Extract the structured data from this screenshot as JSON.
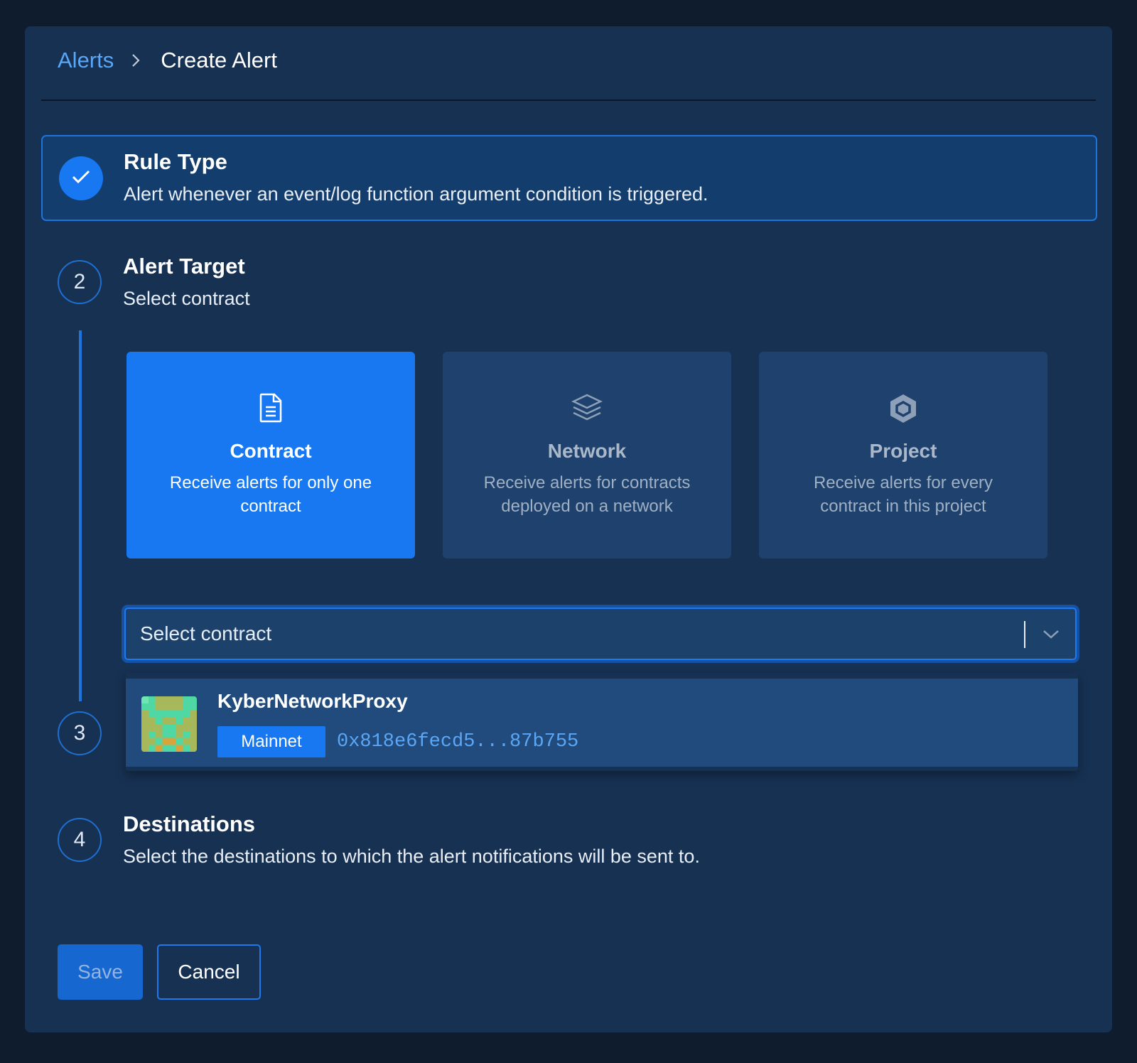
{
  "breadcrumb": {
    "parent": "Alerts",
    "current": "Create Alert"
  },
  "steps": [
    {
      "number": "",
      "title": "Rule Type",
      "description": "Alert whenever an event/log function argument condition is triggered.",
      "status": "completed",
      "icon": "check-icon"
    },
    {
      "number": "2",
      "title": "Alert Target",
      "description": "Select contract",
      "status": "active"
    },
    {
      "number": "3",
      "title": "",
      "description": "",
      "status": "pending"
    },
    {
      "number": "4",
      "title": "Destinations",
      "description": "Select the destinations to which the alert notifications will be sent to.",
      "status": "pending"
    }
  ],
  "target_options": [
    {
      "title": "Contract",
      "description": "Receive alerts for only one contract",
      "icon": "document-icon",
      "selected": true
    },
    {
      "title": "Network",
      "description": "Receive alerts for contracts deployed on a network",
      "icon": "layers-icon",
      "selected": false
    },
    {
      "title": "Project",
      "description": "Receive alerts for every contract in this project",
      "icon": "hexagon-icon",
      "selected": false
    }
  ],
  "contract_select": {
    "placeholder": "Select contract",
    "icon": "chevron-down-icon",
    "options": [
      {
        "name": "KyberNetworkProxy",
        "network": "Mainnet",
        "address": "0x818e6fecd5...87b755",
        "avatar": "identicon"
      }
    ]
  },
  "actions": {
    "save": "Save",
    "cancel": "Cancel"
  },
  "colors": {
    "background": "#0f1c2e",
    "panel": "#173153",
    "accent": "#1778f2",
    "link": "#5ba7f7"
  }
}
